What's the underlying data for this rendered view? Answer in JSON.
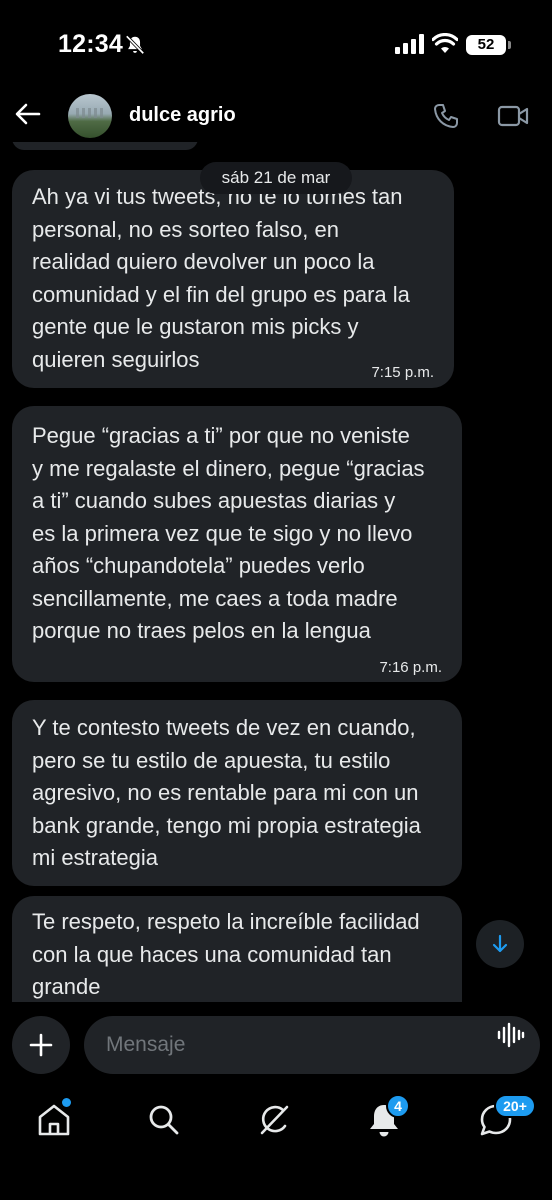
{
  "status_bar": {
    "time": "12:34",
    "battery": "52"
  },
  "header": {
    "contact_name": "dulce agrio"
  },
  "date_divider": "sáb 21 de mar",
  "messages": [
    {
      "text": "Ah ya vi tus tweets, no te lo tomes tan\npersonal, no es sorteo falso, en\nrealidad quiero devolver un poco  la\ncomunidad y el fin del grupo es para la\ngente que le gustaron mis picks y\nquieren seguirlos",
      "time": "7:15 p.m."
    },
    {
      "text": "Pegue “gracias a ti” por que no veniste\ny me regalaste el dinero, pegue “gracias\na ti” cuando subes apuestas diarias y\nes la primera vez que te sigo y no llevo\naños “chupandotela” puedes verlo\nsencillamente, me caes a toda madre\nporque no traes pelos en la lengua",
      "time": "7:16 p.m."
    },
    {
      "text": "Y te contesto tweets de vez en cuando,\npero se tu estilo de apuesta, tu estilo\nagresivo, no es rentable para mi con un\nbank grande, tengo mi propia estrategia\nmi estrategia"
    },
    {
      "text": "Te respeto, respeto la increíble facilidad\ncon la que haces una comunidad tan\ngrande"
    }
  ],
  "composer": {
    "placeholder": "Mensaje"
  },
  "bottom_nav": {
    "notifications_badge": "4",
    "messages_badge": "20+"
  },
  "colors": {
    "background": "#000000",
    "bubble": "#202327",
    "accent": "#1d9bf0",
    "muted": "#71767b"
  },
  "icons": [
    "bell-off-icon",
    "signal-icon",
    "wifi-icon",
    "battery-icon",
    "back-arrow-icon",
    "phone-icon",
    "video-camera-icon",
    "arrow-down-icon",
    "plus-icon",
    "voice-waveform-icon",
    "home-icon",
    "search-icon",
    "grok-icon",
    "bell-icon",
    "messages-icon"
  ]
}
